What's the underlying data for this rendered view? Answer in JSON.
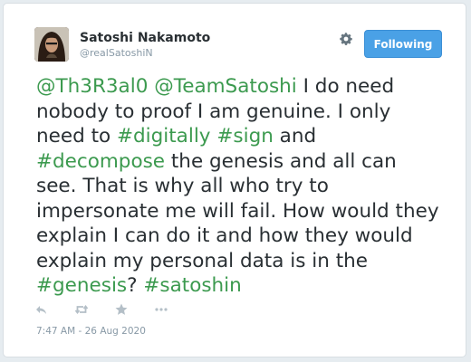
{
  "author": {
    "display_name": "Satoshi Nakamoto",
    "handle": "@realSatoshiN"
  },
  "follow_button": {
    "label": "Following"
  },
  "tweet": {
    "segments": [
      {
        "text": "@Th3R3al0",
        "type": "mention"
      },
      {
        "text": " ",
        "type": "text"
      },
      {
        "text": "@TeamSatoshi",
        "type": "mention"
      },
      {
        "text": " I do need nobody to proof I am genuine. I only need to ",
        "type": "text"
      },
      {
        "text": "#digitally",
        "type": "hashtag"
      },
      {
        "text": " ",
        "type": "text"
      },
      {
        "text": "#sign",
        "type": "hashtag"
      },
      {
        "text": " and ",
        "type": "text"
      },
      {
        "text": "#decompose",
        "type": "hashtag"
      },
      {
        "text": " the genesis and all can see. That is why all who try to impersonate me will fail. How would they explain I can do it and how they would explain my personal data is in the ",
        "type": "text"
      },
      {
        "text": "#genesis",
        "type": "hashtag"
      },
      {
        "text": "? ",
        "type": "text"
      },
      {
        "text": "#satoshin",
        "type": "hashtag"
      }
    ],
    "timestamp": "7:47 AM - 26 Aug 2020"
  },
  "icons": {
    "settings": "gear-icon",
    "reply": "reply-icon",
    "retweet": "retweet-icon",
    "favorite": "star-icon",
    "more": "more-icon"
  },
  "colors": {
    "link": "#3c9a4f",
    "button": "#4aa1e6",
    "muted": "#8899a6",
    "text": "#292f33"
  }
}
